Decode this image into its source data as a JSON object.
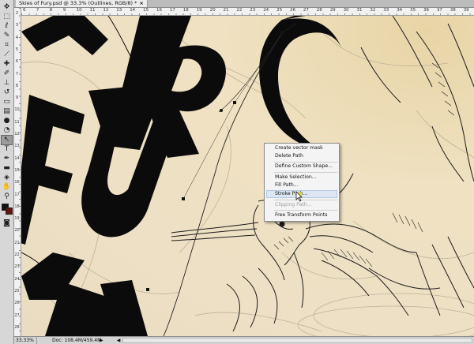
{
  "document": {
    "tab_title": "Skies of Fury.psd @ 33.3% (Outlines, RGB/8) *",
    "close_glyph": "×"
  },
  "rulers": {
    "top_numbers": [
      "6",
      "7",
      "8",
      "9",
      "10",
      "11",
      "12",
      "13",
      "14",
      "15",
      "16",
      "17",
      "18",
      "19",
      "20",
      "21",
      "22",
      "23",
      "24",
      "25",
      "26",
      "27",
      "28",
      "29",
      "30",
      "31",
      "32",
      "33",
      "34",
      "35",
      "36",
      "37",
      "38",
      "39"
    ],
    "left_numbers": [
      "2",
      "3",
      "4",
      "5",
      "6",
      "7",
      "8",
      "9",
      "10",
      "11",
      "12",
      "13",
      "14",
      "15",
      "16",
      "17",
      "18",
      "19",
      "20",
      "21",
      "22",
      "23",
      "24",
      "25",
      "26",
      "27",
      "28"
    ]
  },
  "artwork": {
    "letters": [
      "F",
      "U",
      "R",
      "Y"
    ],
    "colors": {
      "ink": "#0b0b0b",
      "paper": "#efe1c1",
      "sketch": "#b9ad93"
    }
  },
  "context_menu": {
    "items": [
      {
        "label": "Create vector mask",
        "enabled": true
      },
      {
        "label": "Delete Path",
        "enabled": true
      },
      {
        "label": "Define Custom Shape...",
        "enabled": true
      },
      {
        "label": "Make Selection...",
        "enabled": true
      },
      {
        "label": "Fill Path...",
        "enabled": true
      },
      {
        "label": "Stroke Path...",
        "enabled": true,
        "highlighted": true
      },
      {
        "label": "Clipping Path...",
        "enabled": false
      },
      {
        "label": "Free Transform Points",
        "enabled": true
      }
    ]
  },
  "status_bar": {
    "zoom": "33.33%",
    "doc_info": "Doc: 108.4M/459.4M",
    "arrow": "▶",
    "scroll_left": "◀"
  },
  "tools": {
    "foreground_color": "#111111",
    "background_color": "#6b1010"
  }
}
